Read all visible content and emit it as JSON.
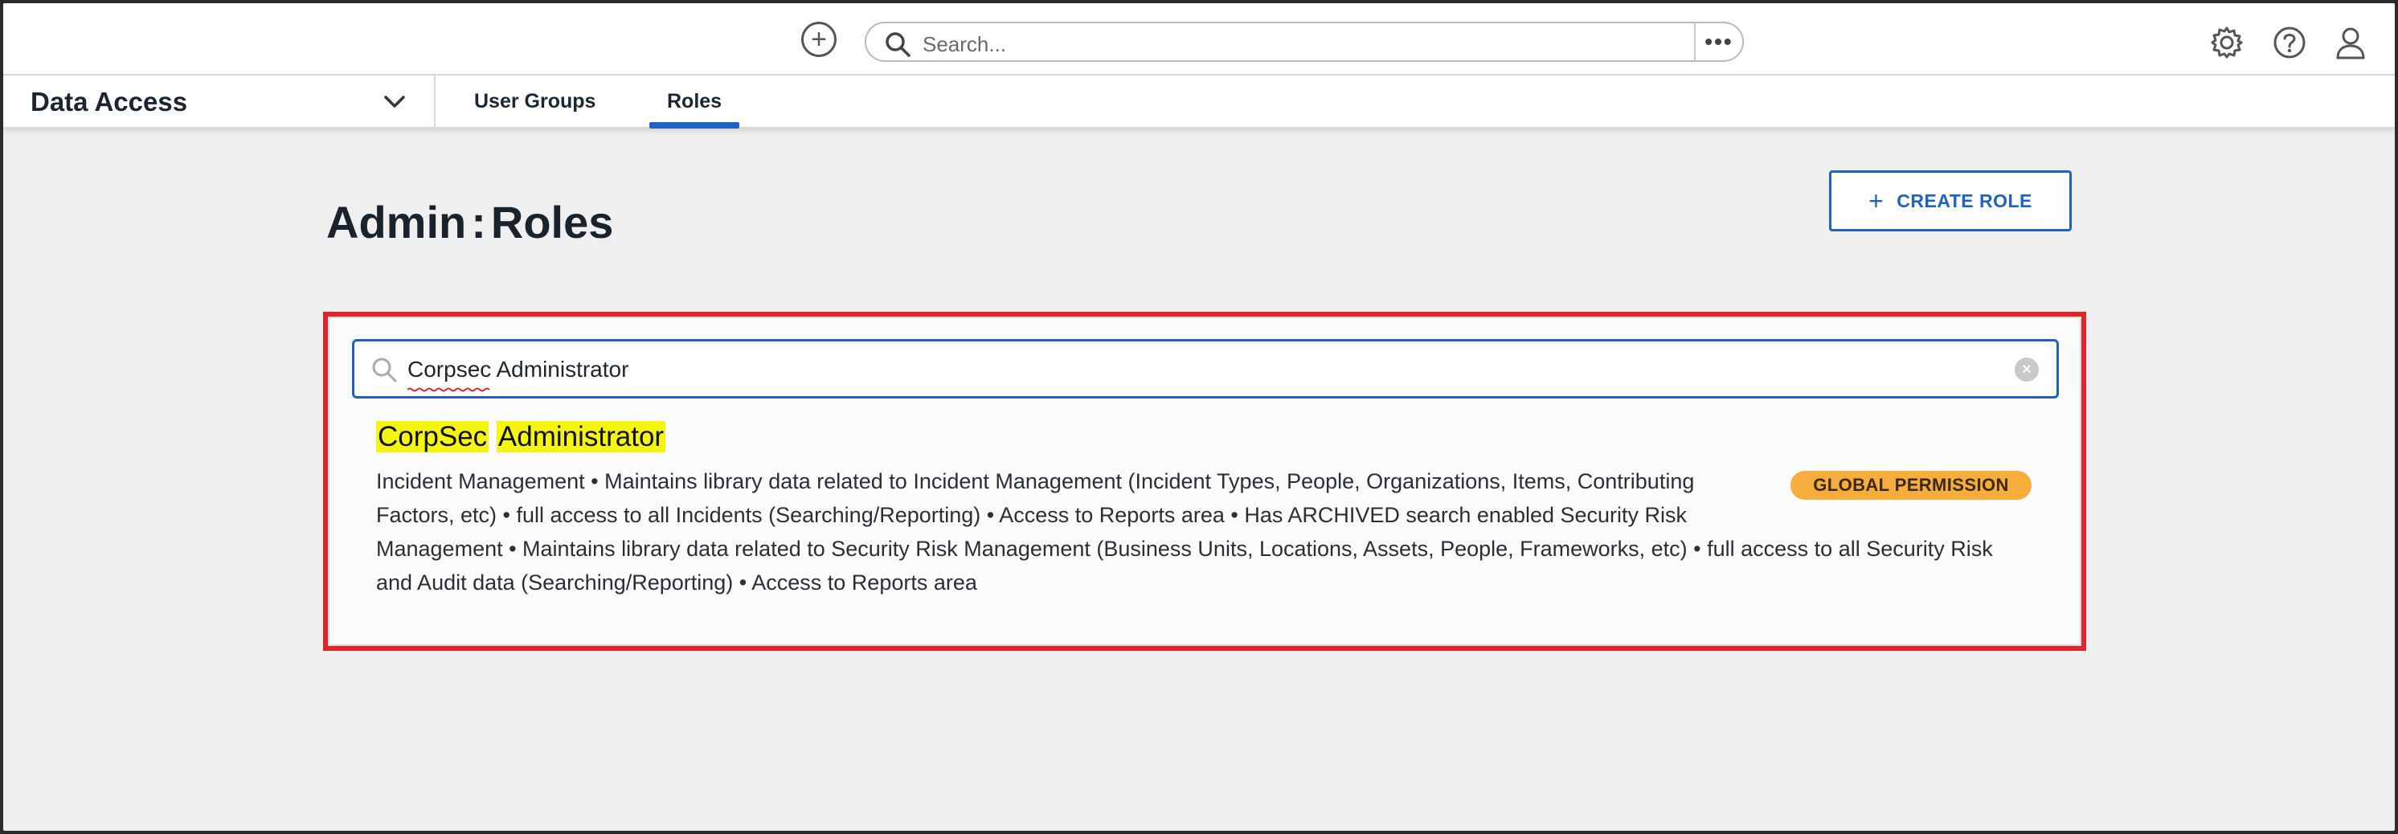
{
  "topbar": {
    "search_placeholder": "Search...",
    "more_label": "•••"
  },
  "nav": {
    "app_name": "Data Access",
    "tabs": [
      {
        "label": "User Groups"
      },
      {
        "label": "Roles"
      }
    ]
  },
  "page": {
    "title_left": "Admin",
    "title_sep": ":",
    "title_right": "Roles",
    "create_button": "CREATE ROLE"
  },
  "filter": {
    "value": "Corpsec Administrator",
    "clear_label": "×"
  },
  "result": {
    "title_parts": [
      "CorpSec",
      "Administrator"
    ],
    "description": "Incident Management • Maintains library data related to Incident Management (Incident Types, People, Organizations, Items, Contributing Factors, etc) • full access to all Incidents (Searching/Reporting) • Access to Reports area • Has ARCHIVED search enabled Security Risk Management • Maintains library data related to Security Risk Management (Business Units, Locations, Assets, People, Frameworks, etc) • full access to all Security Risk and Audit data (Searching/Reporting) • Access to Reports area",
    "badge": "GLOBAL PERMISSION"
  },
  "colors": {
    "accent": "#1e63c3",
    "highlight": "#f5f50f",
    "badge": "#f6ad3b",
    "annotation_border": "#e0262b"
  }
}
